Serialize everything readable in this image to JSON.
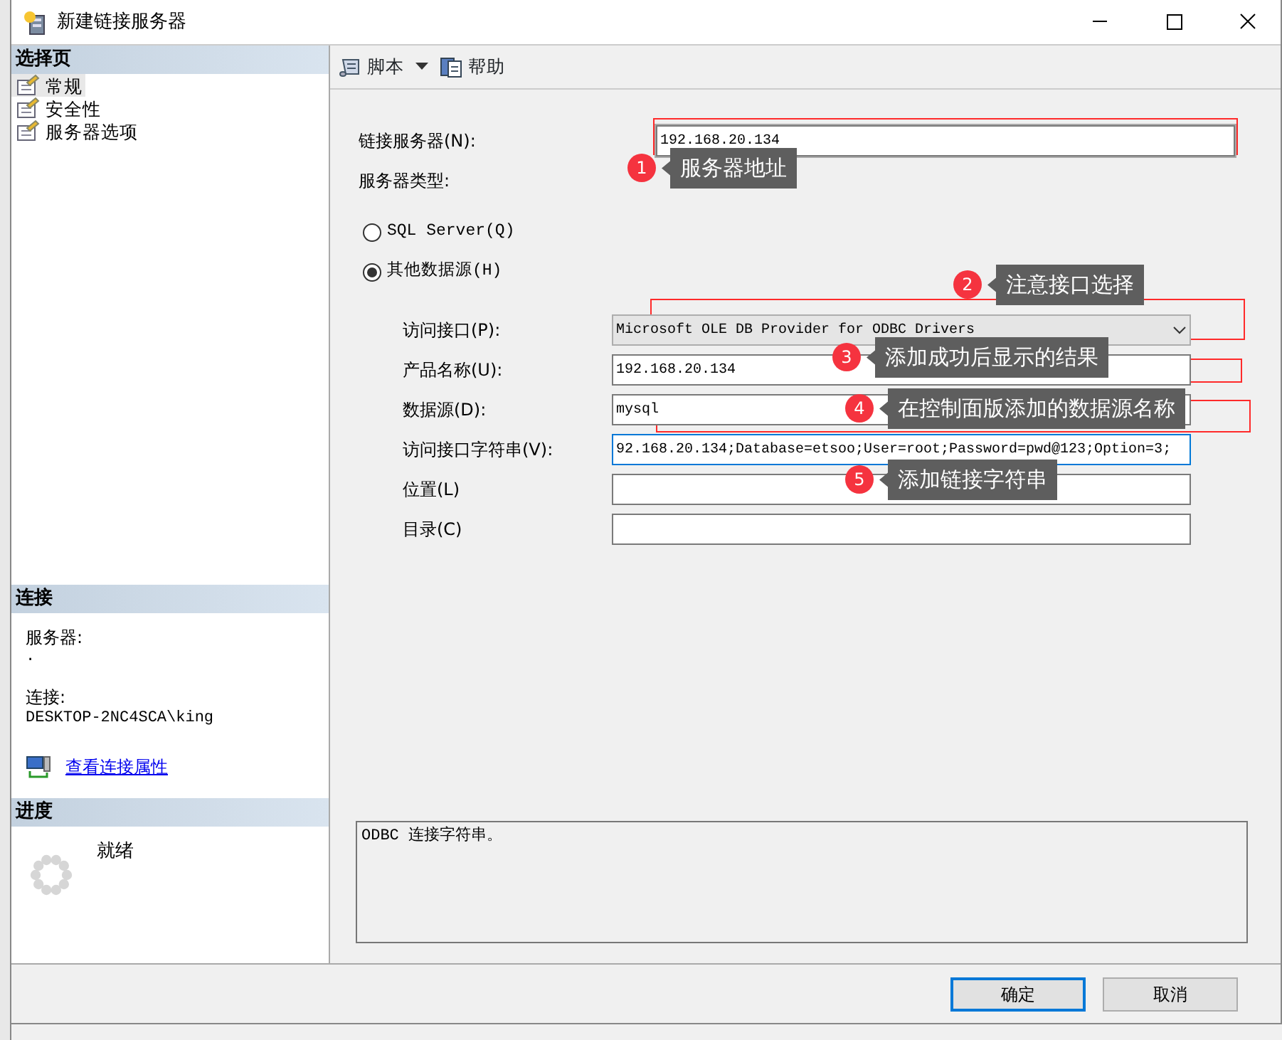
{
  "window": {
    "title": "新建链接服务器"
  },
  "sidebar": {
    "header": "选择页",
    "items": [
      {
        "label": "常规",
        "selected": true
      },
      {
        "label": "安全性",
        "selected": false
      },
      {
        "label": "服务器选项",
        "selected": false
      }
    ]
  },
  "connection": {
    "header": "连接",
    "server_label": "服务器:",
    "server_value": ".",
    "connection_label": "连接:",
    "connection_value": "DESKTOP-2NC4SCA\\king",
    "link": "查看连接属性"
  },
  "progress": {
    "header": "进度",
    "status": "就绪"
  },
  "toolbar": [
    {
      "label": "脚本",
      "dropdown": true
    },
    {
      "label": "帮助",
      "dropdown": false
    }
  ],
  "form": {
    "linked_server": {
      "label": "链接服务器(N):",
      "value": "192.168.20.134"
    },
    "server_type_label": "服务器类型:",
    "server_types": [
      {
        "label": "SQL Server(Q)",
        "selected": false
      },
      {
        "label": "其他数据源(H)",
        "selected": true
      }
    ],
    "fields": [
      {
        "kind": "select",
        "label": "访问接口(P):",
        "value": "Microsoft OLE DB Provider for ODBC Drivers",
        "focused": false
      },
      {
        "kind": "text",
        "label": "产品名称(U):",
        "value": "192.168.20.134",
        "focused": false
      },
      {
        "kind": "text",
        "label": "数据源(D):",
        "value": "mysql",
        "focused": false
      },
      {
        "kind": "text",
        "label": "访问接口字符串(V):",
        "value": "92.168.20.134;Database=etsoo;User=root;Password=pwd@123;Option=3;",
        "focused": true
      },
      {
        "kind": "text",
        "label": "位置(L)",
        "focused": false
      },
      {
        "kind": "text",
        "label": "目录(C)",
        "focused": false
      }
    ]
  },
  "description": "ODBC 连接字符串。",
  "buttons": [
    {
      "label": "确定",
      "default": true
    },
    {
      "label": "取消",
      "default": false
    }
  ],
  "annotations": [
    {
      "number": "1",
      "text": "服务器地址"
    },
    {
      "number": "2",
      "text": "注意接口选择"
    },
    {
      "number": "3",
      "text": "添加成功后显示的结果"
    },
    {
      "number": "4",
      "text": "在控制面版添加的数据源名称"
    },
    {
      "number": "5",
      "text": "添加链接字符串"
    }
  ]
}
